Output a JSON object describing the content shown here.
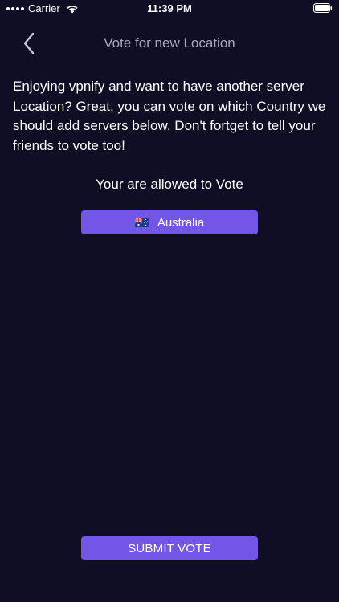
{
  "status_bar": {
    "carrier": "Carrier",
    "time": "11:39 PM"
  },
  "nav": {
    "title": "Vote for new Location",
    "back_icon": "chevron-left-icon"
  },
  "intro": {
    "text": "Enjoying vpnify and want to have another server Location? Great, you can vote on which Country we should add servers below. Don't fortget to tell your friends to vote too!"
  },
  "vote": {
    "allowed_label": "Your are allowed to Vote",
    "country_label": "Australia",
    "country_flag_icon": "australia-flag-icon"
  },
  "submit": {
    "label": "SUBMIT VOTE"
  },
  "colors": {
    "background": "#0f0e25",
    "accent": "#7356e6",
    "nav_title": "#a8a8ba",
    "text": "#ffffff"
  }
}
